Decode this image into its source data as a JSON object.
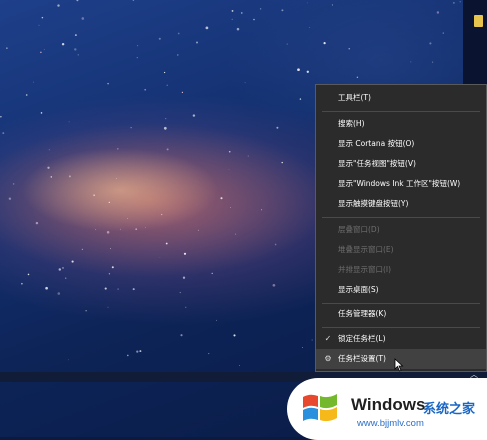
{
  "context_menu": {
    "items": [
      {
        "label": "工具栏(T)",
        "enabled": true
      },
      {
        "label": "搜索(H)",
        "enabled": true
      },
      {
        "label": "显示 Cortana 按钮(O)",
        "enabled": true
      },
      {
        "label": "显示\"任务视图\"按钮(V)",
        "enabled": true
      },
      {
        "label": "显示\"Windows Ink 工作区\"按钮(W)",
        "enabled": true
      },
      {
        "label": "显示触摸键盘按钮(Y)",
        "enabled": true
      },
      {
        "label": "层叠窗口(D)",
        "enabled": false
      },
      {
        "label": "堆叠显示窗口(E)",
        "enabled": false
      },
      {
        "label": "并排显示窗口(I)",
        "enabled": false
      },
      {
        "label": "显示桌面(S)",
        "enabled": true
      },
      {
        "label": "任务管理器(K)",
        "enabled": true
      },
      {
        "label": "锁定任务栏(L)",
        "enabled": true,
        "checked": true,
        "icon": "checkmark-icon"
      },
      {
        "label": "任务栏设置(T)",
        "enabled": true,
        "icon": "gear-icon",
        "hovered": true
      }
    ]
  },
  "watermark": {
    "brand": "Windows",
    "brand_cn": "系统之家",
    "url": "www.bjjmlv.com"
  },
  "colors": {
    "menu_bg": "#2b2b2b",
    "menu_hover": "#414141",
    "disabled_text": "#6e6e6e",
    "accent_blue": "#1a66c4"
  }
}
